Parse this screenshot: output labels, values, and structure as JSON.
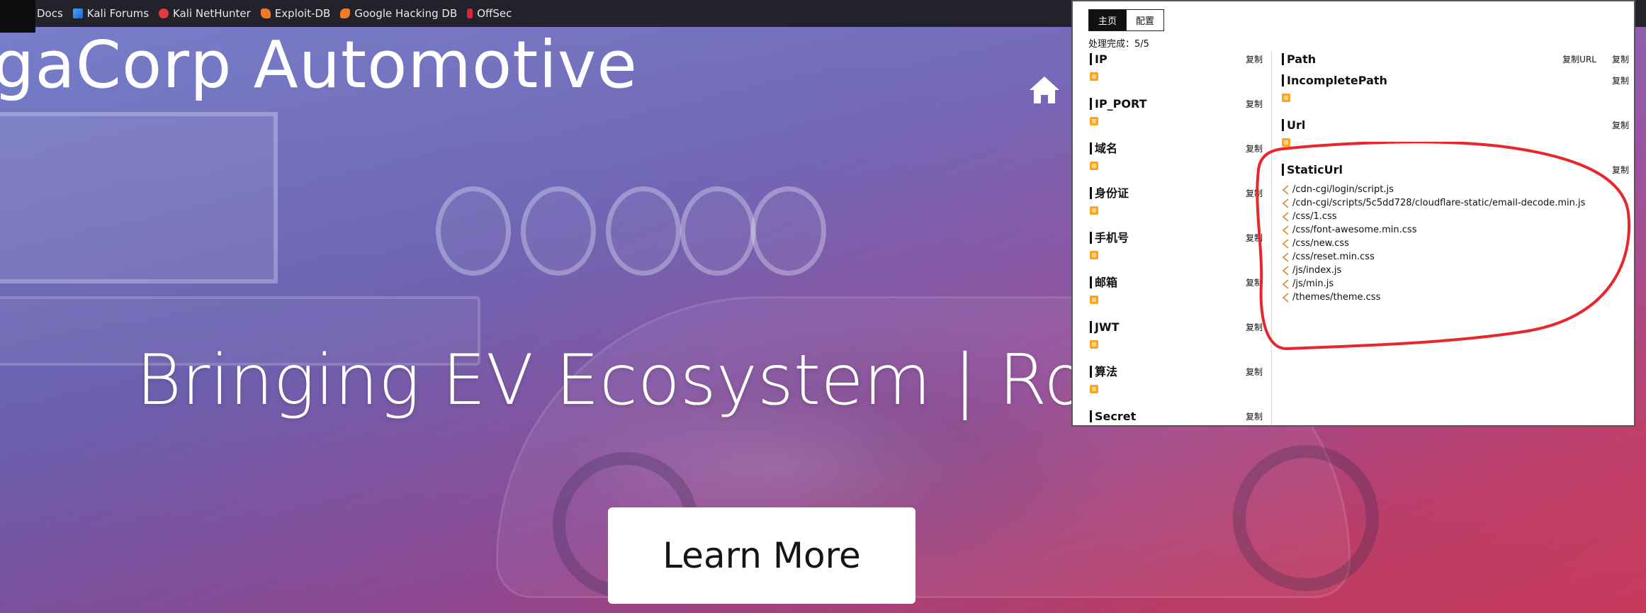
{
  "bookmarks": [
    {
      "label": "Docs",
      "icon": "docs-icon"
    },
    {
      "label": "Kali Forums",
      "icon": "kali-forums-icon"
    },
    {
      "label": "Kali NetHunter",
      "icon": "nethunter-icon"
    },
    {
      "label": "Exploit-DB",
      "icon": "exploit-db-icon"
    },
    {
      "label": "Google Hacking DB",
      "icon": "ghdb-icon"
    },
    {
      "label": "OffSec",
      "icon": "offsec-icon"
    }
  ],
  "hero": {
    "brand": "gaCorp Automotive",
    "tagline": "Bringing EV Ecosystem | Robu",
    "cta": "Learn More",
    "home_icon": "home-icon"
  },
  "popup": {
    "tabs": [
      "主页",
      "配置"
    ],
    "status": "处理完成：5/5",
    "copy_label": "复制",
    "copy_url_label": "复制URL",
    "left_sections": [
      {
        "title": "IP"
      },
      {
        "title": "IP_PORT"
      },
      {
        "title": "域名"
      },
      {
        "title": "身份证"
      },
      {
        "title": "手机号"
      },
      {
        "title": "邮箱"
      },
      {
        "title": "JWT"
      },
      {
        "title": "算法"
      },
      {
        "title": "Secret"
      }
    ],
    "right_sections": [
      {
        "title": "Path"
      },
      {
        "title": "IncompletePath"
      },
      {
        "title": "Url"
      },
      {
        "title": "StaticUrl"
      }
    ],
    "static_urls": [
      "/cdn-cgi/login/script.js",
      "/cdn-cgi/scripts/5c5dd728/cloudflare-static/email-decode.min.js",
      "/css/1.css",
      "/css/font-awesome.min.css",
      "/css/new.css",
      "/css/reset.min.css",
      "/js/index.js",
      "/js/min.js",
      "/themes/theme.css"
    ]
  },
  "colors": {
    "annotation": "#e8262e",
    "badge": "#f5a623",
    "hero_start": "#6f78c6",
    "hero_end": "#d83f63"
  }
}
